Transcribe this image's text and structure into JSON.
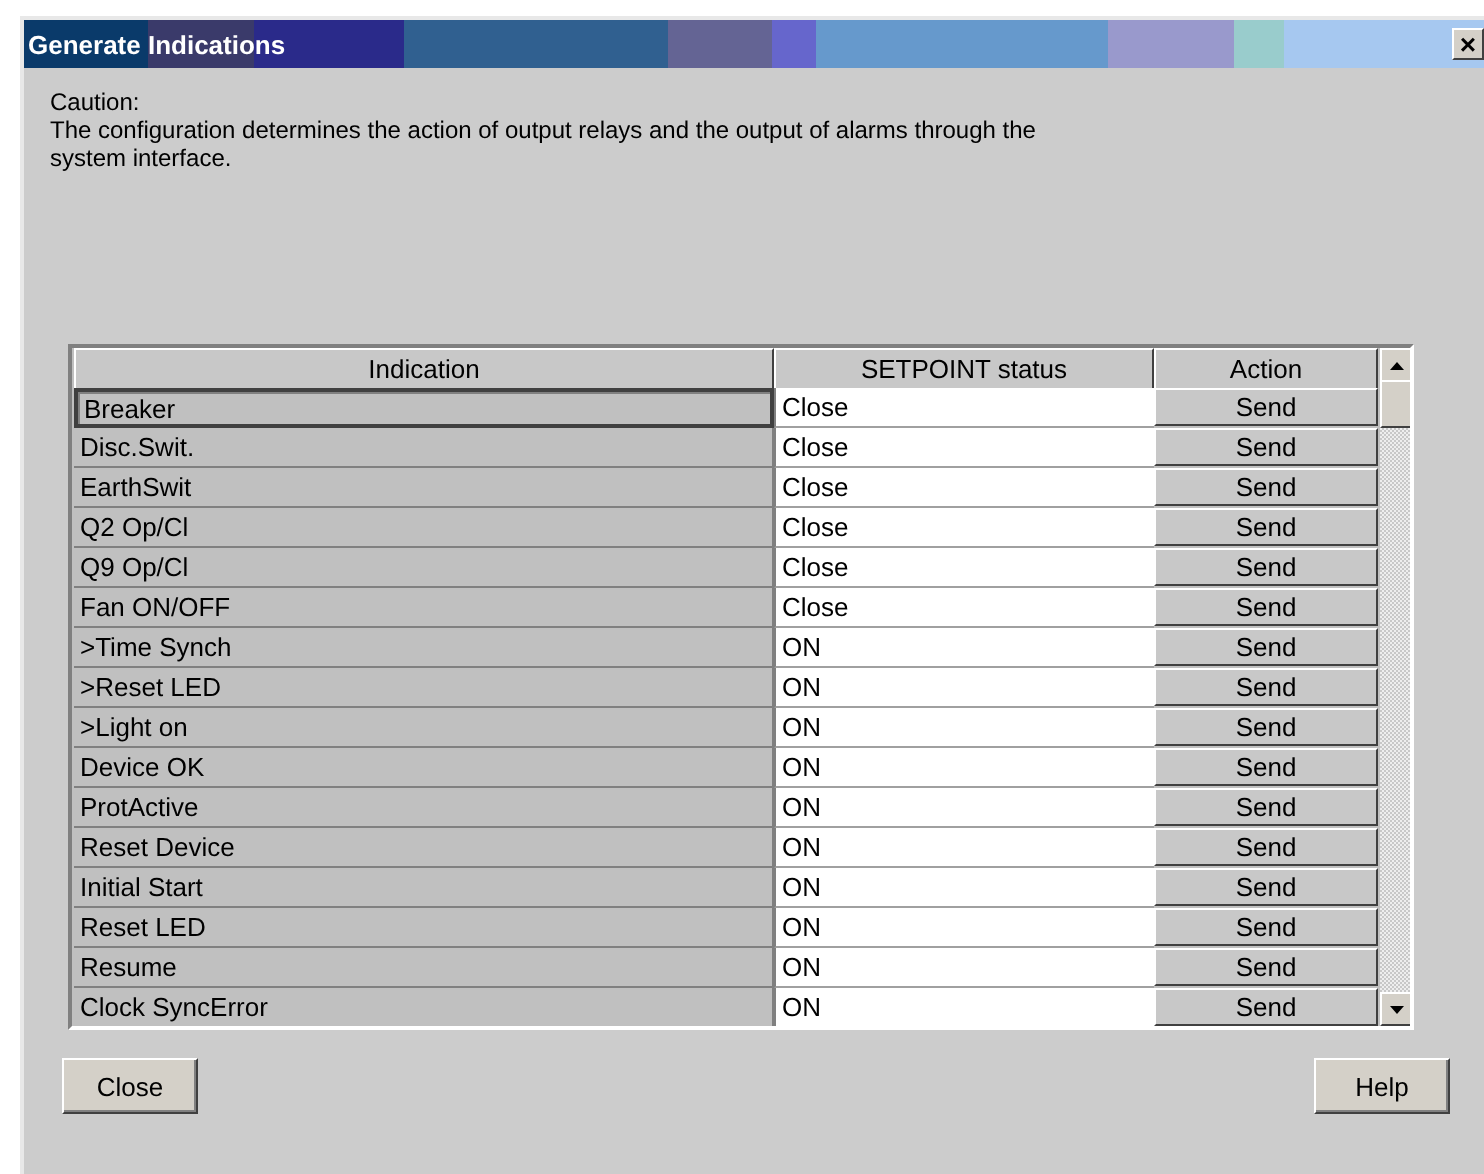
{
  "window": {
    "title": "Generate Indications",
    "close_glyph": "×"
  },
  "caution": {
    "heading": "Caution:",
    "text": "The configuration determines the action of output relays and the output of alarms through the system interface."
  },
  "table": {
    "columns": [
      "Indication",
      "SETPOINT status",
      "Action"
    ],
    "rows": [
      {
        "indication": "Breaker",
        "status": "Close",
        "action": "Send",
        "selected": true
      },
      {
        "indication": "Disc.Swit.",
        "status": "Close",
        "action": "Send",
        "selected": false
      },
      {
        "indication": "EarthSwit",
        "status": "Close",
        "action": "Send",
        "selected": false
      },
      {
        "indication": "Q2 Op/Cl",
        "status": "Close",
        "action": "Send",
        "selected": false
      },
      {
        "indication": "Q9 Op/Cl",
        "status": "Close",
        "action": "Send",
        "selected": false
      },
      {
        "indication": "Fan ON/OFF",
        "status": "Close",
        "action": "Send",
        "selected": false
      },
      {
        "indication": ">Time Synch",
        "status": "ON",
        "action": "Send",
        "selected": false
      },
      {
        "indication": ">Reset LED",
        "status": "ON",
        "action": "Send",
        "selected": false
      },
      {
        "indication": ">Light on",
        "status": "ON",
        "action": "Send",
        "selected": false
      },
      {
        "indication": "Device OK",
        "status": "ON",
        "action": "Send",
        "selected": false
      },
      {
        "indication": "ProtActive",
        "status": "ON",
        "action": "Send",
        "selected": false
      },
      {
        "indication": "Reset Device",
        "status": "ON",
        "action": "Send",
        "selected": false
      },
      {
        "indication": "Initial Start",
        "status": "ON",
        "action": "Send",
        "selected": false
      },
      {
        "indication": "Reset LED",
        "status": "ON",
        "action": "Send",
        "selected": false
      },
      {
        "indication": "Resume",
        "status": "ON",
        "action": "Send",
        "selected": false
      },
      {
        "indication": "Clock SyncError",
        "status": "ON",
        "action": "Send",
        "selected": false
      }
    ]
  },
  "buttons": {
    "close": "Close",
    "help": "Help"
  }
}
